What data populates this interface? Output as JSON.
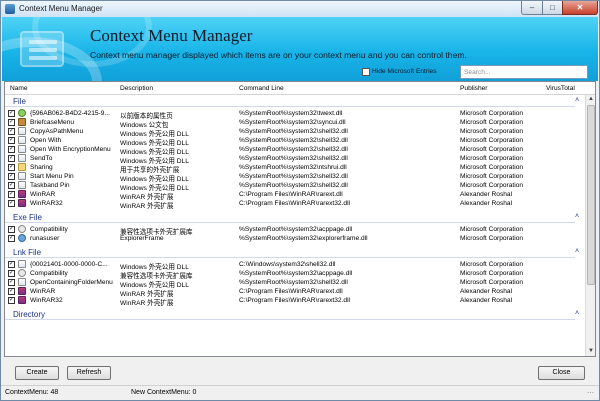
{
  "window": {
    "title": "Context Menu Manager"
  },
  "banner": {
    "heading": "Context Menu Manager",
    "subtitle": "Context menu manager displayed which items are on your context menu and you can control them.",
    "hide_microsoft_label": "Hide Microsoft Entries",
    "hide_microsoft_checked": false,
    "search_placeholder": "Search..."
  },
  "columns": [
    "Name",
    "Description",
    "Command Line",
    "Publisher",
    "VirusTotal"
  ],
  "groups": [
    {
      "title": "File",
      "rows": [
        {
          "checked": true,
          "icon": "globe-icon",
          "name": "{596AB062-B4D2-4215-9...",
          "description": "以前版本的属性页",
          "command": "%SystemRoot%\\system32\\twext.dll",
          "publisher": "Microsoft Corporation"
        },
        {
          "checked": true,
          "icon": "briefcase-icon",
          "name": "BriefcaseMenu",
          "description": "Windows 公文包",
          "command": "%SystemRoot%\\system32\\syncui.dll",
          "publisher": "Microsoft Corporation"
        },
        {
          "checked": true,
          "icon": "app-icon",
          "name": "CopyAsPathMenu",
          "description": "Windows 外壳公用 DLL",
          "command": "%SystemRoot%\\system32\\shell32.dll",
          "publisher": "Microsoft Corporation"
        },
        {
          "checked": true,
          "icon": "app-icon",
          "name": "Open With",
          "description": "Windows 外壳公用 DLL",
          "command": "%SystemRoot%\\system32\\shell32.dll",
          "publisher": "Microsoft Corporation"
        },
        {
          "checked": true,
          "icon": "app-icon",
          "name": "Open With EncryptionMenu",
          "description": "Windows 外壳公用 DLL",
          "command": "%SystemRoot%\\system32\\shell32.dll",
          "publisher": "Microsoft Corporation"
        },
        {
          "checked": true,
          "icon": "app-icon",
          "name": "SendTo",
          "description": "Windows 外壳公用 DLL",
          "command": "%SystemRoot%\\system32\\shell32.dll",
          "publisher": "Microsoft Corporation"
        },
        {
          "checked": true,
          "icon": "folder-icon",
          "name": "Sharing",
          "description": "用于共享的外壳扩展",
          "command": "%SystemRoot%\\system32\\ntshrui.dll",
          "publisher": "Microsoft Corporation"
        },
        {
          "checked": true,
          "icon": "app-icon",
          "name": "Start Menu Pin",
          "description": "Windows 外壳公用 DLL",
          "command": "%SystemRoot%\\system32\\shell32.dll",
          "publisher": "Microsoft Corporation"
        },
        {
          "checked": true,
          "icon": "app-icon",
          "name": "Taskband Pin",
          "description": "Windows 外壳公用 DLL",
          "command": "%SystemRoot%\\system32\\shell32.dll",
          "publisher": "Microsoft Corporation"
        },
        {
          "checked": true,
          "icon": "winrar-icon",
          "name": "WinRAR",
          "description": "WinRAR 外壳扩展",
          "command": "C:\\Program Files\\WinRAR\\rarext.dll",
          "publisher": "Alexander Roshal"
        },
        {
          "checked": true,
          "icon": "winrar-icon",
          "name": "WinRAR32",
          "description": "WinRAR 外壳扩展",
          "command": "C:\\Program Files\\WinRAR\\rarext32.dll",
          "publisher": "Alexander Roshal"
        }
      ]
    },
    {
      "title": "Exe File",
      "rows": [
        {
          "checked": true,
          "icon": "gear-icon",
          "name": "Compatibility",
          "description": "兼容性选项卡外壳扩展库",
          "command": "%SystemRoot%\\system32\\acppage.dll",
          "publisher": "Microsoft Corporation"
        },
        {
          "checked": true,
          "icon": "user-icon",
          "name": "runasuser",
          "description": "ExplorerFrame",
          "command": "%SystemRoot%\\system32\\explorerframe.dll",
          "publisher": "Microsoft Corporation"
        }
      ]
    },
    {
      "title": "Lnk File",
      "rows": [
        {
          "checked": true,
          "icon": "app-icon",
          "name": "{00021401-0000-0000-C...",
          "description": "Windows 外壳公用 DLL",
          "command": "C:\\Windows\\system32\\shell32.dll",
          "publisher": "Microsoft Corporation"
        },
        {
          "checked": true,
          "icon": "gear-icon",
          "name": "Compatibility",
          "description": "兼容性选项卡外壳扩展库",
          "command": "%SystemRoot%\\system32\\acppage.dll",
          "publisher": "Microsoft Corporation"
        },
        {
          "checked": true,
          "icon": "app-icon",
          "name": "OpenContainingFolderMenu",
          "description": "Windows 外壳公用 DLL",
          "command": "%SystemRoot%\\system32\\shell32.dll",
          "publisher": "Microsoft Corporation"
        },
        {
          "checked": true,
          "icon": "winrar-icon",
          "name": "WinRAR",
          "description": "WinRAR 外壳扩展",
          "command": "C:\\Program Files\\WinRAR\\rarext.dll",
          "publisher": "Alexander Roshal"
        },
        {
          "checked": true,
          "icon": "winrar-icon",
          "name": "WinRAR32",
          "description": "WinRAR 外壳扩展",
          "command": "C:\\Program Files\\WinRAR\\rarext32.dll",
          "publisher": "Alexander Roshal"
        }
      ]
    },
    {
      "title": "Directory",
      "rows": []
    }
  ],
  "buttons": {
    "create": "Create",
    "refresh": "Refresh",
    "close": "Close"
  },
  "status": {
    "context_menu": "ContextMenu: 48",
    "new_context_menu": "New ContextMenu: 0"
  }
}
